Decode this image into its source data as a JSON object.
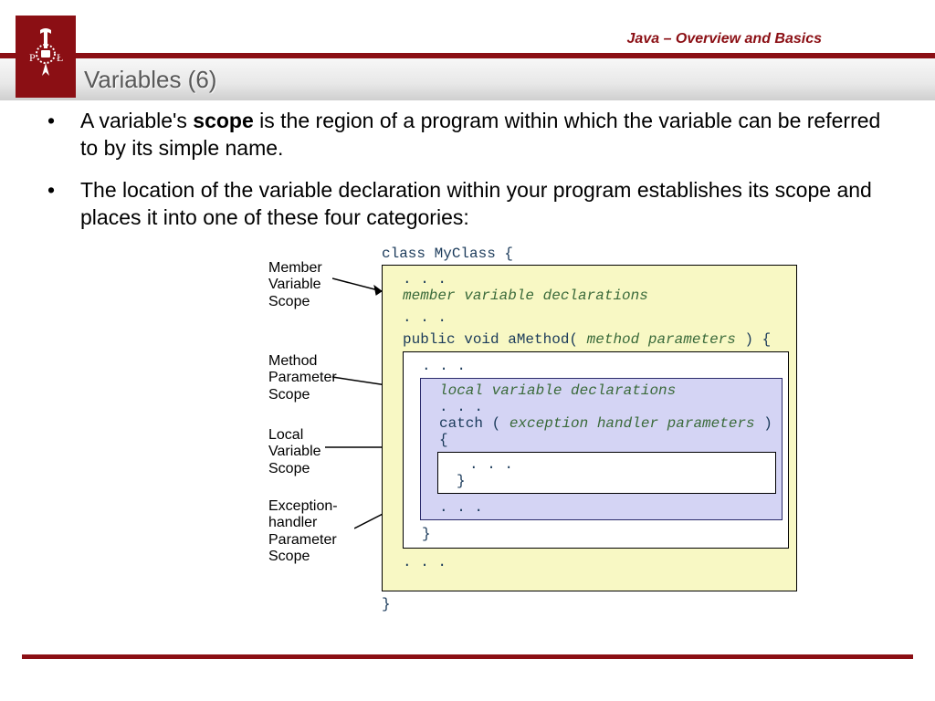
{
  "header": {
    "course": "Java – Overview and Basics",
    "title": "Variables (6)"
  },
  "bullets": {
    "b1a": "A variable's ",
    "b1bold": "scope",
    "b1b": " is the region of a program within which the variable can be referred to by its simple name.",
    "b2": "The location of the variable declaration within your program establishes its scope and places it into one of these four categories:"
  },
  "diagram": {
    "labels": {
      "member": "Member\nVariable\nScope",
      "method": "Method\nParameter\nScope",
      "local": "Local\nVariable\nScope",
      "exc": "Exception-\nhandler\nParameter\nScope"
    },
    "code": {
      "class_open": "class MyClass {",
      "dots": ". . .",
      "member_decl": "member variable declarations",
      "method_sig_a": "public void aMethod( ",
      "method_sig_b": "method parameters",
      "method_sig_c": " ) {",
      "local_decl": "local variable declarations",
      "catch_a": "catch ( ",
      "catch_b": "exception handler parameters",
      "catch_c": " ) {",
      "brace": "}",
      "class_close": "}"
    }
  }
}
